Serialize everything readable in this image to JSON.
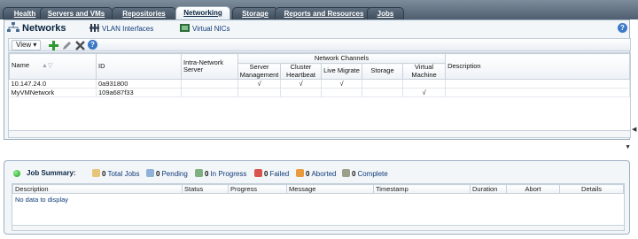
{
  "tabs": [
    {
      "label": "Health",
      "active": false
    },
    {
      "label": "Servers and VMs",
      "active": false
    },
    {
      "label": "Repositories",
      "active": false
    },
    {
      "label": "Networking",
      "active": true
    },
    {
      "label": "Storage",
      "active": false
    },
    {
      "label": "Reports and Resources",
      "active": false
    },
    {
      "label": "Jobs",
      "active": false
    }
  ],
  "panel": {
    "title": "Networks",
    "links": [
      "VLAN Interfaces",
      "Virtual NICs"
    ],
    "help_glyph": "?"
  },
  "toolbar": {
    "view_label": "View ▾",
    "icons": [
      "add-icon",
      "edit-icon",
      "delete-icon",
      "help-icon"
    ]
  },
  "grid": {
    "headers": {
      "name": "Name",
      "id": "ID",
      "intra_network_server": "Intra-Network Server",
      "network_channels": "Network Channels",
      "server_management": "Server Management",
      "cluster_heartbeat": "Cluster Heartbeat",
      "live_migrate": "Live Migrate",
      "storage": "Storage",
      "virtual_machine": "Virtual Machine",
      "description": "Description"
    },
    "sort_indicator": "▲▽",
    "rows": [
      {
        "name": "10.147.24.0",
        "id": "0a931800",
        "intra": "",
        "server_management": "√",
        "cluster_heartbeat": "√",
        "live_migrate": "√",
        "storage": "",
        "virtual_machine": "",
        "description": ""
      },
      {
        "name": "MyVMNetwork",
        "id": "109a687f33",
        "intra": "",
        "server_management": "",
        "cluster_heartbeat": "",
        "live_migrate": "",
        "storage": "",
        "virtual_machine": "√",
        "description": ""
      }
    ]
  },
  "job_summary": {
    "title": "Job Summary:",
    "stats": [
      {
        "count": "0",
        "label": "Total Jobs",
        "color": "#e8c47a"
      },
      {
        "count": "0",
        "label": "Pending",
        "color": "#8fb2d9"
      },
      {
        "count": "0",
        "label": "In Progress",
        "color": "#7fb07f"
      },
      {
        "count": "0",
        "label": "Failed",
        "color": "#d9534f"
      },
      {
        "count": "0",
        "label": "Aborted",
        "color": "#e89a3c"
      },
      {
        "count": "0",
        "label": "Complete",
        "color": "#9aa08a"
      }
    ],
    "columns": [
      "Description",
      "Status",
      "Progress",
      "Message",
      "Timestamp",
      "Duration",
      "Abort",
      "Details"
    ],
    "empty_message": "No data to display"
  },
  "colors": {
    "accent": "#0e3a78",
    "tab_bar": "#4f5f70",
    "panel_bg": "#f3f6f9",
    "border": "#9db0c2"
  }
}
